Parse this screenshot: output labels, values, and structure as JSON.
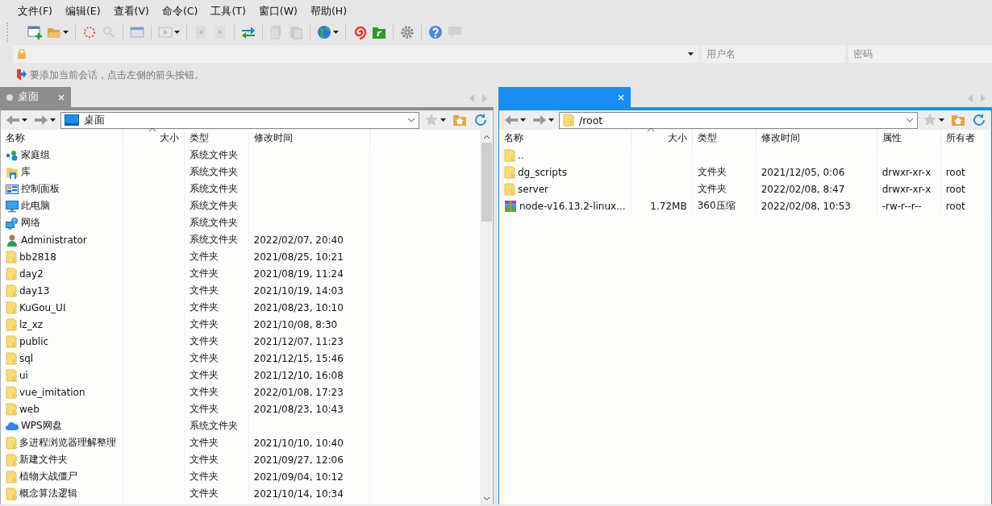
{
  "menu": [
    "文件(F)",
    "编辑(E)",
    "查看(V)",
    "命令(C)",
    "工具(T)",
    "窗口(W)",
    "帮助(H)"
  ],
  "session_bar": {
    "username_placeholder": "用户名",
    "password_placeholder": "密码"
  },
  "hint": "要添加当前会话，点击左侧的箭头按钮。",
  "panes": [
    {
      "active": false,
      "tab": {
        "title": "桌面"
      },
      "path": {
        "kind": "desktop",
        "text": "桌面"
      },
      "scrollbar": true,
      "columns": [
        "名称",
        "大小",
        "类型",
        "修改时间"
      ],
      "rows": [
        {
          "kind": "homegroup",
          "name": "家庭组",
          "type": "系统文件夹"
        },
        {
          "kind": "library",
          "name": "库",
          "type": "系统文件夹"
        },
        {
          "kind": "control-panel",
          "name": "控制面板",
          "type": "系统文件夹"
        },
        {
          "kind": "computer",
          "name": "此电脑",
          "type": "系统文件夹"
        },
        {
          "kind": "network",
          "name": "网络",
          "type": "系统文件夹"
        },
        {
          "kind": "user",
          "name": "Administrator",
          "type": "系统文件夹",
          "modified": "2022/02/07, 20:40"
        },
        {
          "kind": "folder",
          "name": "bb2818",
          "type": "文件夹",
          "modified": "2021/08/25, 10:21"
        },
        {
          "kind": "folder",
          "name": "day2",
          "type": "文件夹",
          "modified": "2021/08/19, 11:24"
        },
        {
          "kind": "folder",
          "name": "day13",
          "type": "文件夹",
          "modified": "2021/10/19, 14:03"
        },
        {
          "kind": "folder",
          "name": "KuGou_UI",
          "type": "文件夹",
          "modified": "2021/08/23, 10:10"
        },
        {
          "kind": "folder",
          "name": "lz_xz",
          "type": "文件夹",
          "modified": "2021/10/08, 8:30"
        },
        {
          "kind": "folder",
          "name": "public",
          "type": "文件夹",
          "modified": "2021/12/07, 11:23"
        },
        {
          "kind": "folder",
          "name": "sql",
          "type": "文件夹",
          "modified": "2021/12/15, 15:46"
        },
        {
          "kind": "folder",
          "name": "ui",
          "type": "文件夹",
          "modified": "2021/12/10, 16:08"
        },
        {
          "kind": "folder",
          "name": "vue_imitation",
          "type": "文件夹",
          "modified": "2022/01/08, 17:23"
        },
        {
          "kind": "folder",
          "name": "web",
          "type": "文件夹",
          "modified": "2021/08/23, 10:43"
        },
        {
          "kind": "cloud",
          "name": "WPS网盘",
          "type": "系统文件夹"
        },
        {
          "kind": "folder",
          "name": "多进程浏览器理解整理",
          "type": "文件夹",
          "modified": "2021/10/10, 10:40"
        },
        {
          "kind": "folder",
          "name": "新建文件夹",
          "type": "文件夹",
          "modified": "2021/09/27, 12:06"
        },
        {
          "kind": "folder",
          "name": "植物大战僵尸",
          "type": "文件夹",
          "modified": "2021/09/04, 10:12"
        },
        {
          "kind": "folder",
          "name": "概念算法逻辑",
          "type": "文件夹",
          "modified": "2021/10/14, 10:34"
        }
      ]
    },
    {
      "active": true,
      "path": {
        "kind": "folder",
        "text": "/root"
      },
      "scrollbar": false,
      "columns": [
        "名称",
        "大小",
        "类型",
        "修改时间",
        "属性",
        "所有者"
      ],
      "rows": [
        {
          "kind": "folder",
          "name": ".."
        },
        {
          "kind": "folder",
          "name": "dg_scripts",
          "type": "文件夹",
          "modified": "2021/12/05, 0:06",
          "attributes": "drwxr-xr-x",
          "owner": "root"
        },
        {
          "kind": "folder",
          "name": "server",
          "type": "文件夹",
          "modified": "2022/02/08, 8:47",
          "attributes": "drwxr-xr-x",
          "owner": "root"
        },
        {
          "kind": "archive",
          "name": "node-v16.13.2-linux...",
          "size": "1.72MB",
          "type": "360压缩",
          "modified": "2022/02/08, 10:53",
          "attributes": "-rw-r--r--",
          "owner": "root"
        }
      ]
    }
  ]
}
